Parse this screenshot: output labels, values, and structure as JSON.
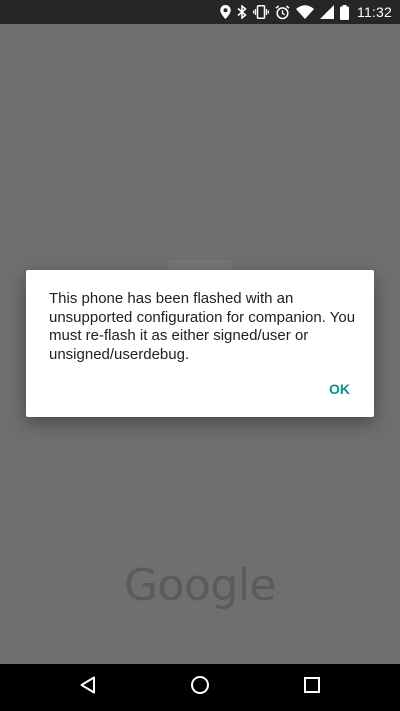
{
  "status_bar": {
    "time": "11:32",
    "icons": [
      "location-icon",
      "bluetooth-icon",
      "vibrate-icon",
      "alarm-icon",
      "wifi-icon",
      "signal-icon",
      "battery-icon"
    ]
  },
  "background": {
    "logo_text": "Google"
  },
  "dialog": {
    "message": "This phone has been flashed with an unsupported configuration for companion. You must re-flash it as either signed/user or unsigned/userdebug.",
    "ok_label": "OK",
    "accent_color": "#009688"
  },
  "nav_bar": {
    "buttons": [
      "back-icon",
      "home-icon",
      "recents-icon"
    ]
  }
}
